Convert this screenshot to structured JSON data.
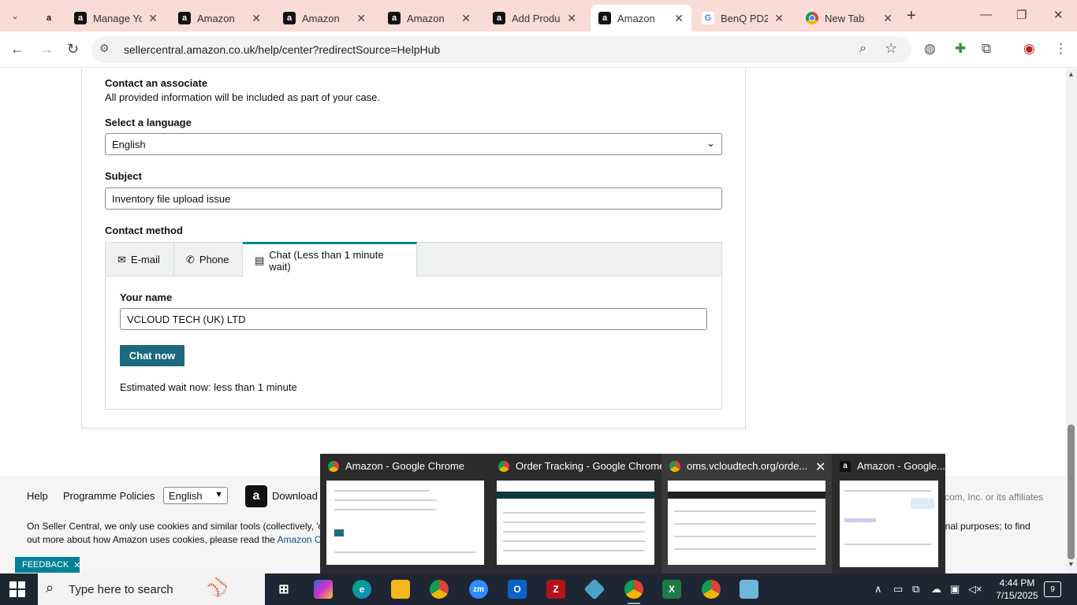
{
  "browser": {
    "tabs": [
      {
        "title": "Manage Yo",
        "icon": "amazon",
        "active": false
      },
      {
        "title": "Amazon",
        "icon": "amazon",
        "active": false
      },
      {
        "title": "Amazon",
        "icon": "amazon",
        "active": false
      },
      {
        "title": "Amazon",
        "icon": "amazon",
        "active": false
      },
      {
        "title": "Add Produ",
        "icon": "amazon",
        "active": false
      },
      {
        "title": "Amazon",
        "icon": "amazon",
        "active": true
      },
      {
        "title": "BenQ PD27",
        "icon": "google",
        "active": false
      },
      {
        "title": "New Tab",
        "icon": "chrome",
        "active": false
      }
    ],
    "url": "sellercentral.amazon.co.uk/help/center?redirectSource=HelpHub"
  },
  "form": {
    "heading": "Contact an associate",
    "subheading": "All provided information will be included as part of your case.",
    "language_label": "Select a language",
    "language_value": "English",
    "subject_label": "Subject",
    "subject_value": "Inventory file upload issue",
    "contact_method_label": "Contact method",
    "methods": [
      {
        "label": "E-mail",
        "icon": "mail-icon"
      },
      {
        "label": "Phone",
        "icon": "phone-icon"
      },
      {
        "label": "Chat (Less than 1 minute wait)",
        "icon": "chat-icon",
        "selected": true
      }
    ],
    "name_label": "Your name",
    "name_value": "VCLOUD TECH (UK) LTD",
    "chat_button": "Chat now",
    "wait_text": "Estimated wait now: less than 1 minute"
  },
  "footer": {
    "help": "Help",
    "policies": "Programme Policies",
    "language": "English",
    "download": "Download th",
    "copyright": "com, Inc. or its affiliates",
    "cookie_line1": "On Seller Central, we only use cookies and similar tools (collectively, 'co",
    "cookie_line1_end": "onal purposes; to find",
    "cookie_line2": "out more about how Amazon uses cookies, please read the ",
    "cookie_link": "Amazon Co",
    "feedback": "FEEDBACK"
  },
  "thumbnails": [
    {
      "title": "Amazon - Google Chrome",
      "icon": "chrome"
    },
    {
      "title": "Order Tracking - Google Chrome",
      "icon": "chrome"
    },
    {
      "title": "oms.vcloudtech.org/orde...",
      "icon": "chrome"
    },
    {
      "title": "Amazon - Google...",
      "icon": "amazon"
    }
  ],
  "taskbar": {
    "search_placeholder": "Type here to search",
    "time": "4:44 PM",
    "date": "7/15/2025",
    "notifications": "9"
  }
}
